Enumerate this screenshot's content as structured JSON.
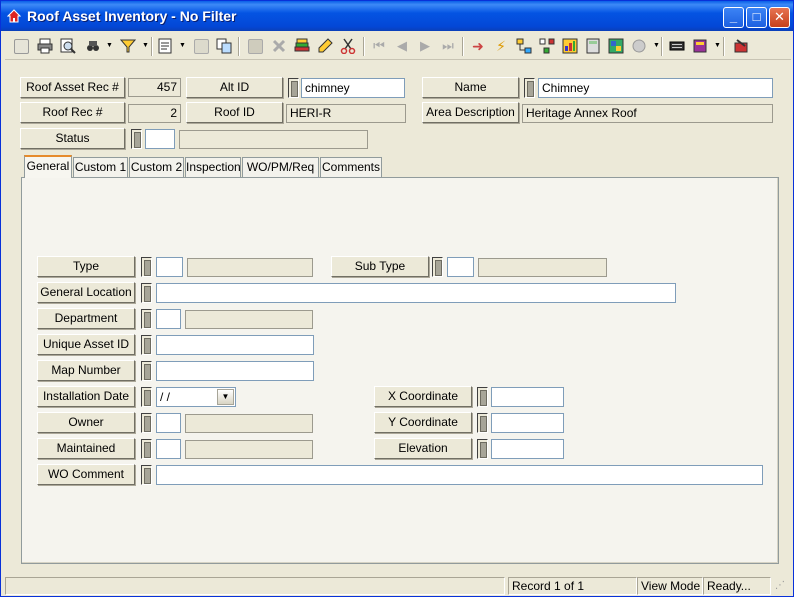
{
  "window": {
    "title": "Roof Asset Inventory - No Filter",
    "minimize": "_",
    "maximize": "□",
    "close": "✕"
  },
  "header": {
    "roof_asset_rec_label": "Roof Asset Rec #",
    "roof_asset_rec_value": "457",
    "alt_id_label": "Alt ID",
    "alt_id_value": "chimney",
    "name_label": "Name",
    "name_value": "Chimney",
    "roof_rec_label": "Roof Rec #",
    "roof_rec_value": "2",
    "roof_id_label": "Roof ID",
    "roof_id_value": "HERI-R",
    "area_description_label": "Area Description",
    "area_description_value": "Heritage Annex Roof",
    "status_label": "Status",
    "status_code": "",
    "status_desc": ""
  },
  "tabs": [
    {
      "label": "General"
    },
    {
      "label": "Custom 1"
    },
    {
      "label": "Custom 2"
    },
    {
      "label": "Inspection"
    },
    {
      "label": "WO/PM/Req"
    },
    {
      "label": "Comments"
    }
  ],
  "general": {
    "type_label": "Type",
    "type_code": "",
    "type_desc": "",
    "sub_type_label": "Sub Type",
    "sub_type_code": "",
    "sub_type_desc": "",
    "general_location_label": "General Location",
    "general_location_value": "",
    "department_label": "Department",
    "department_code": "",
    "department_desc": "",
    "unique_asset_id_label": "Unique Asset ID",
    "unique_asset_id_value": "",
    "map_number_label": "Map Number",
    "map_number_value": "",
    "installation_date_label": "Installation Date",
    "installation_date_value": " /  /",
    "x_coordinate_label": "X Coordinate",
    "x_coordinate_value": "",
    "owner_label": "Owner",
    "owner_code": "",
    "owner_desc": "",
    "y_coordinate_label": "Y Coordinate",
    "y_coordinate_value": "",
    "maintained_label": "Maintained",
    "maintained_code": "",
    "maintained_desc": "",
    "elevation_label": "Elevation",
    "elevation_value": "",
    "wo_comment_label": "WO Comment",
    "wo_comment_value": ""
  },
  "status_bar": {
    "record": "Record 1 of 1",
    "mode": "View Mode",
    "state": "Ready..."
  }
}
